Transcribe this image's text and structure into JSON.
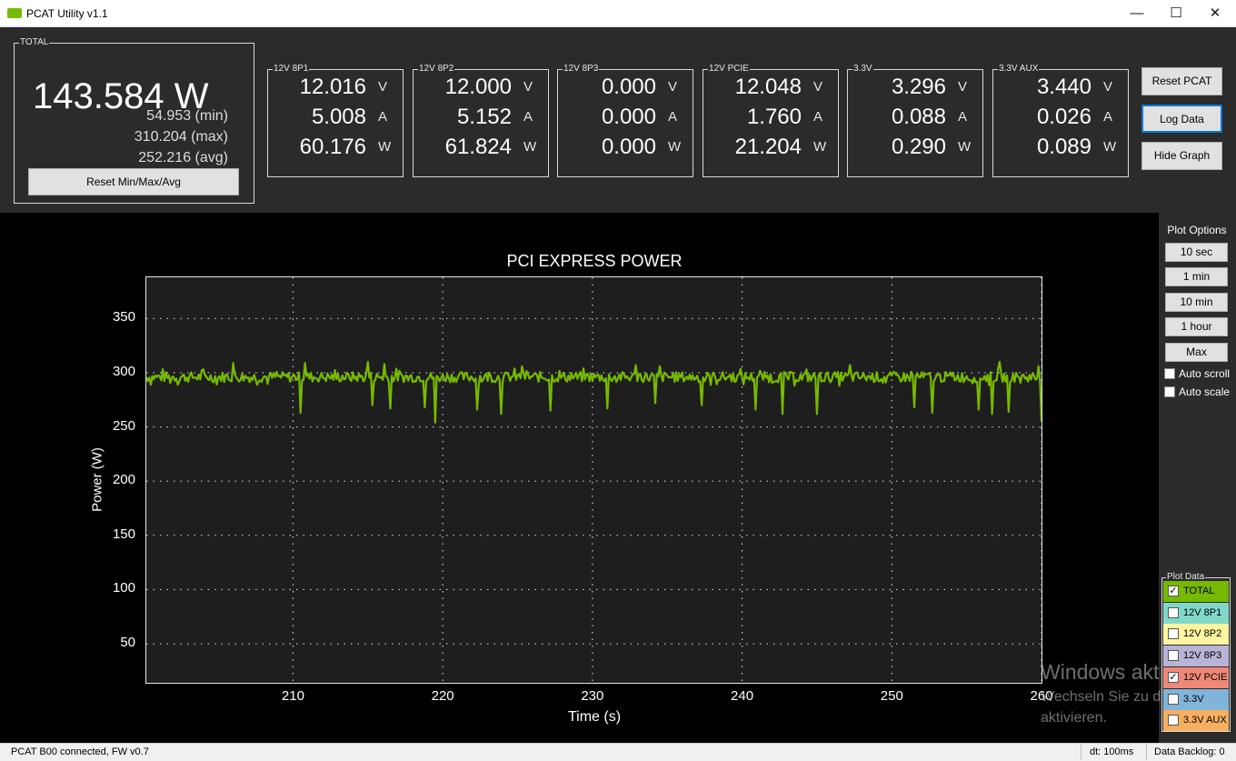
{
  "window": {
    "title": "PCAT Utility v1.1",
    "minimize": "—",
    "maximize": "☐",
    "close": "✕"
  },
  "total": {
    "legend": "TOTAL",
    "power": "143.584 W",
    "min": "54.953 (min)",
    "max": "310.204 (max)",
    "avg": "252.216 (avg)",
    "reset_label": "Reset Min/Max/Avg"
  },
  "rails": [
    {
      "name": "12V 8P1",
      "volts": "12.016",
      "amps": "5.008",
      "watts": "60.176"
    },
    {
      "name": "12V 8P2",
      "volts": "12.000",
      "amps": "5.152",
      "watts": "61.824"
    },
    {
      "name": "12V 8P3",
      "volts": "0.000",
      "amps": "0.000",
      "watts": "0.000"
    },
    {
      "name": "12V PCIE",
      "volts": "12.048",
      "amps": "1.760",
      "watts": "21.204"
    },
    {
      "name": "3.3V",
      "volts": "3.296",
      "amps": "0.088",
      "watts": "0.290"
    },
    {
      "name": "3.3V AUX",
      "volts": "3.440",
      "amps": "0.026",
      "watts": "0.089"
    }
  ],
  "units": {
    "v": "V",
    "a": "A",
    "w": "W"
  },
  "buttons": {
    "reset_pcat": "Reset PCAT",
    "log_data": "Log Data",
    "hide_graph": "Hide Graph"
  },
  "plot_options": {
    "title": "Plot Options",
    "ranges": [
      "10 sec",
      "1 min",
      "10 min",
      "1 hour",
      "Max"
    ],
    "auto_scroll": "Auto scroll",
    "auto_scale": "Auto scale"
  },
  "plot_data": {
    "legend": "Plot Data",
    "items": [
      {
        "label": "TOTAL",
        "checked": true,
        "color": "#76b900"
      },
      {
        "label": "12V 8P1",
        "checked": false,
        "color": "#80d8c8"
      },
      {
        "label": "12V 8P2",
        "checked": false,
        "color": "#fff5a0"
      },
      {
        "label": "12V 8P3",
        "checked": false,
        "color": "#b8b4d8"
      },
      {
        "label": "12V PCIE",
        "checked": true,
        "color": "#f08878"
      },
      {
        "label": "3.3V",
        "checked": false,
        "color": "#80b4d8"
      },
      {
        "label": "3.3V AUX",
        "checked": false,
        "color": "#f8b060"
      }
    ]
  },
  "chart_data": {
    "type": "line",
    "title": "PCI EXPRESS POWER",
    "xlabel": "Time (s)",
    "ylabel": "Power (W)",
    "xlim": [
      200.2,
      260
    ],
    "ylim": [
      14,
      388
    ],
    "xticks": [
      210,
      220,
      230,
      240,
      250,
      260
    ],
    "yticks": [
      50,
      100,
      150,
      200,
      250,
      300,
      350
    ],
    "grid": true,
    "series": [
      {
        "name": "TOTAL",
        "color": "#76b900",
        "x_start": 200.2,
        "x_end": 260,
        "baseline": 296,
        "noise": 6,
        "dips": [
          [
            210.5,
            263
          ],
          [
            215.3,
            270
          ],
          [
            216.5,
            267
          ],
          [
            218.8,
            268
          ],
          [
            219.5,
            254
          ],
          [
            222.3,
            266
          ],
          [
            223.9,
            262
          ],
          [
            227.2,
            265
          ],
          [
            231.0,
            267
          ],
          [
            234.2,
            272
          ],
          [
            237.3,
            270
          ],
          [
            240.9,
            266
          ],
          [
            242.7,
            262
          ],
          [
            245.0,
            262
          ],
          [
            251.5,
            268
          ],
          [
            252.7,
            263
          ],
          [
            255.8,
            266
          ],
          [
            256.7,
            262
          ],
          [
            257.8,
            264
          ],
          [
            260.0,
            255
          ]
        ],
        "peaks": [
          [
            206.0,
            309
          ],
          [
            210.8,
            309
          ],
          [
            215.0,
            310
          ],
          [
            216.1,
            308
          ],
          [
            225.3,
            306
          ],
          [
            232.9,
            307
          ],
          [
            234.5,
            306
          ],
          [
            247.2,
            307
          ],
          [
            257.2,
            310
          ],
          [
            259.8,
            306
          ]
        ]
      }
    ]
  },
  "watermark": {
    "line1": "Windows akt",
    "line2": "Wechseln Sie zu d",
    "line3": "aktivieren."
  },
  "status": {
    "left": "PCAT B00 connected, FW v0.7",
    "dt": "dt: 100ms",
    "backlog": "Data Backlog: 0"
  }
}
